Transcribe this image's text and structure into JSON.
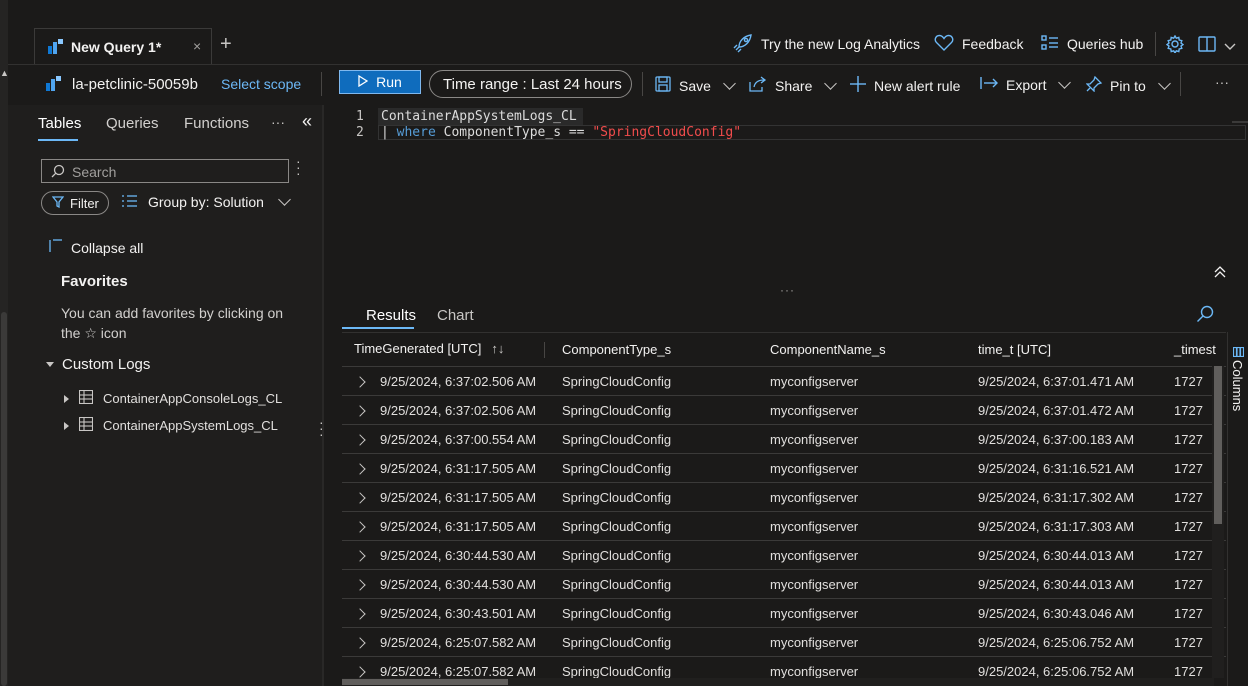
{
  "tab": {
    "title": "New Query 1*",
    "close": "×",
    "new_tab": "+"
  },
  "topbar": {
    "try_new": "Try the new Log Analytics",
    "feedback": "Feedback",
    "queries_hub": "Queries hub"
  },
  "scope": {
    "name": "la-petclinic-50059b",
    "select_scope": "Select scope"
  },
  "toolbar": {
    "run": "Run",
    "time_range_label": "Time range : ",
    "time_range_value": "Last 24 hours",
    "save": "Save",
    "share": "Share",
    "new_alert": "New alert rule",
    "export": "Export",
    "pin_to": "Pin to",
    "more": "···"
  },
  "left_panel": {
    "tabs": [
      "Tables",
      "Queries",
      "Functions"
    ],
    "more": "···",
    "collapse_panel": "«",
    "search_placeholder": "Search",
    "filter": "Filter",
    "group_by": "Group by: Solution",
    "collapse_all": "Collapse all",
    "favorites_title": "Favorites",
    "favorites_text": "You can add favorites by clicking on the ☆ icon",
    "custom_logs": "Custom Logs",
    "tables": [
      "ContainerAppConsoleLogs_CL",
      "ContainerAppSystemLogs_CL"
    ]
  },
  "editor": {
    "line_numbers": [
      "1",
      "2"
    ],
    "line1": "ContainerAppSystemLogs_CL",
    "line2_pipe": "| ",
    "line2_kw": "where",
    "line2_mid": " ComponentType_s == ",
    "line2_str": "\"SpringCloudConfig\""
  },
  "results": {
    "tabs": [
      "Results",
      "Chart"
    ],
    "columns": [
      "TimeGenerated [UTC]",
      "ComponentType_s",
      "ComponentName_s",
      "time_t [UTC]",
      "_timest"
    ],
    "side_label": "Columns",
    "rows": [
      [
        "9/25/2024, 6:37:02.506 AM",
        "SpringCloudConfig",
        "myconfigserver",
        "9/25/2024, 6:37:01.471 AM",
        "1727"
      ],
      [
        "9/25/2024, 6:37:02.506 AM",
        "SpringCloudConfig",
        "myconfigserver",
        "9/25/2024, 6:37:01.472 AM",
        "1727"
      ],
      [
        "9/25/2024, 6:37:00.554 AM",
        "SpringCloudConfig",
        "myconfigserver",
        "9/25/2024, 6:37:00.183 AM",
        "1727"
      ],
      [
        "9/25/2024, 6:31:17.505 AM",
        "SpringCloudConfig",
        "myconfigserver",
        "9/25/2024, 6:31:16.521 AM",
        "1727"
      ],
      [
        "9/25/2024, 6:31:17.505 AM",
        "SpringCloudConfig",
        "myconfigserver",
        "9/25/2024, 6:31:17.302 AM",
        "1727"
      ],
      [
        "9/25/2024, 6:31:17.505 AM",
        "SpringCloudConfig",
        "myconfigserver",
        "9/25/2024, 6:31:17.303 AM",
        "1727"
      ],
      [
        "9/25/2024, 6:30:44.530 AM",
        "SpringCloudConfig",
        "myconfigserver",
        "9/25/2024, 6:30:44.013 AM",
        "1727"
      ],
      [
        "9/25/2024, 6:30:44.530 AM",
        "SpringCloudConfig",
        "myconfigserver",
        "9/25/2024, 6:30:44.013 AM",
        "1727"
      ],
      [
        "9/25/2024, 6:30:43.501 AM",
        "SpringCloudConfig",
        "myconfigserver",
        "9/25/2024, 6:30:43.046 AM",
        "1727"
      ],
      [
        "9/25/2024, 6:25:07.582 AM",
        "SpringCloudConfig",
        "myconfigserver",
        "9/25/2024, 6:25:06.752 AM",
        "1727"
      ],
      [
        "9/25/2024, 6:25:07.582 AM",
        "SpringCloudConfig",
        "myconfigserver",
        "9/25/2024, 6:25:06.752 AM",
        "1727"
      ]
    ]
  },
  "colors": {
    "accent": "#6cb8f6",
    "run_button": "#0f6cbd",
    "string": "#f14c4c",
    "keyword": "#569cd6"
  },
  "icons": [
    "log-analytics-icon",
    "rocket-icon",
    "heart-icon",
    "queries-hub-icon",
    "gear-icon",
    "book-icon",
    "run-play-icon",
    "save-icon",
    "share-icon",
    "plus-icon",
    "export-icon",
    "pin-icon",
    "search-icon",
    "filter-icon",
    "list-icon",
    "collapse-all-icon",
    "table-icon",
    "columns-icon"
  ]
}
